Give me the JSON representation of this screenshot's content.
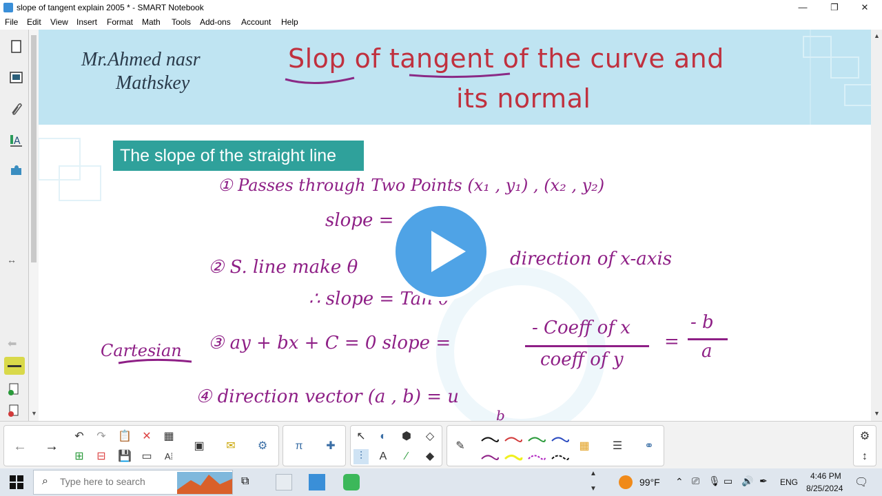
{
  "window": {
    "title": "slope of tangent explain 2005 * - SMART Notebook",
    "minimize": "—",
    "maximize": "❐",
    "close": "✕"
  },
  "menu": [
    "File",
    "Edit",
    "View",
    "Insert",
    "Format",
    "Math",
    "Tools",
    "Add-ons",
    "Account",
    "Help"
  ],
  "slide": {
    "author_line1": "Mr.Ahmed nasr",
    "author_line2": "Mathskey",
    "title_line1": "Slop of tangent of the curve and",
    "title_line2": "its normal",
    "section_heading": "The slope of the straight line",
    "hw": {
      "l1": "① Passes through Two Points  (x₁ , y₁) , (x₂ , y₂)",
      "l2": "slope =",
      "l3": "②  S. line make θ",
      "l3b": "direction of x-axis",
      "l4": "∴ slope = Tan θ",
      "l5a": "Cartesian",
      "l5b": "③  ay + bx + C = 0    slope =",
      "frac_num": "- Coeff of x",
      "frac_den": "coeff of y",
      "frac2_num": "- b",
      "frac2_den": "a",
      "eq": "=",
      "l6": "④  direction vector (a , b) = u",
      "l6b": "b"
    }
  },
  "taskbar": {
    "search_placeholder": "Type here to search",
    "temperature": "99°F",
    "language": "ENG",
    "time": "4:46 PM",
    "date": "8/25/2024"
  },
  "colors": {
    "title_red": "#c0313f",
    "title_purple": "#8a2a86",
    "ink_purple": "#8e1f86",
    "banner": "#bfe4f2",
    "section_teal": "#2fa19b",
    "play_blue": "#4fa3e6"
  }
}
